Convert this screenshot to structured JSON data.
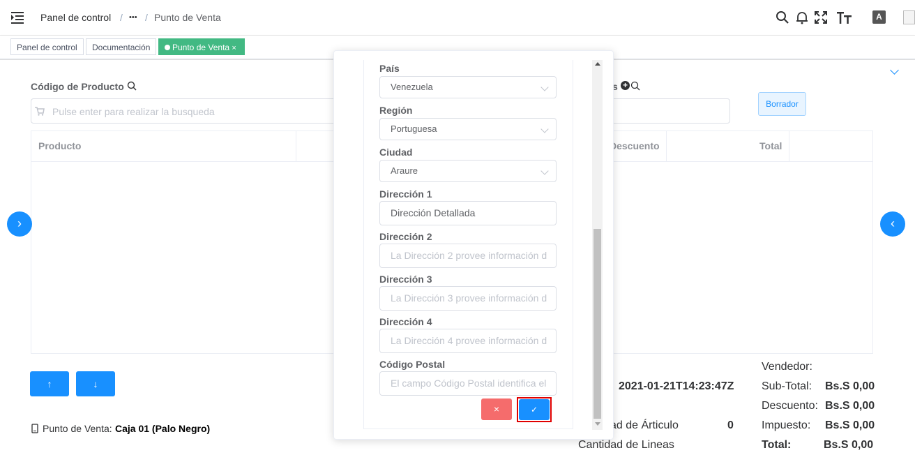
{
  "breadcrumb": {
    "home": "Panel de control",
    "more": "•••",
    "current": "Punto de Venta",
    "sep": "/"
  },
  "navbar_icons": [
    "search-icon",
    "bell-icon",
    "fullscreen-icon",
    "font-size-icon",
    "translate-icon",
    "avatar"
  ],
  "tags": [
    {
      "label": "Panel de control"
    },
    {
      "label": "Documentación"
    },
    {
      "label": "Punto de Venta",
      "close": "×"
    }
  ],
  "pos": {
    "product_code_label": "Código de Producto",
    "product_search_placeholder": "Pulse enter para realizar la busqueda",
    "client_label_tail": "s",
    "draft_button": "Borrador",
    "columns": [
      "Producto",
      "Descuento",
      "Total"
    ],
    "point_of_sale_label": "Punto de Venta:",
    "point_of_sale_value": "Caja 01 (Palo Negro)",
    "date_value": "2021-01-21T14:23:47Z",
    "article_qty_label": "ad de Árticulo",
    "article_qty_value": "0",
    "lines_qty_label": "Cantidad de Lineas"
  },
  "summary": {
    "seller_label": "Vendedor:",
    "subtotal_label": "Sub-Total:",
    "subtotal_value": "Bs.S 0,00",
    "discount_label": "Descuento:",
    "discount_value": "Bs.S 0,00",
    "tax_label": "Impuesto:",
    "tax_value": "Bs.S 0,00",
    "total_label": "Total:",
    "total_value": "Bs.S 0,00"
  },
  "address_form": {
    "country_label": "País",
    "country_value": "Venezuela",
    "region_label": "Región",
    "region_value": "Portuguesa",
    "city_label": "Ciudad",
    "city_value": "Araure",
    "address1_label": "Dirección 1",
    "address1_value": "Dirección Detallada",
    "address2_label": "Dirección 2",
    "address2_placeholder": "La Dirección 2 provee información d",
    "address3_label": "Dirección 3",
    "address3_placeholder": "La Dirección 3 provee información d",
    "address4_label": "Dirección 4",
    "address4_placeholder": "La Dirección 4 provee información d",
    "postal_label": "Código Postal",
    "postal_placeholder": "El campo Código Postal identifica el",
    "cancel_icon": "×",
    "confirm_icon": "✓"
  },
  "colors": {
    "accent": "#1890ff",
    "tag_active": "#42b983",
    "danger": "#f56c6c",
    "highlight": "#e00000"
  }
}
